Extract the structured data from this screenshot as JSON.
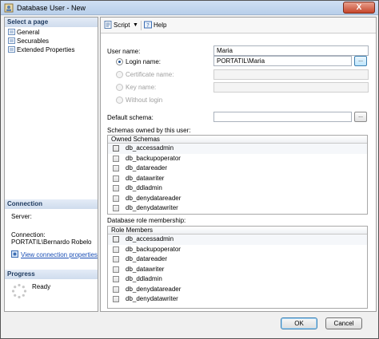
{
  "window": {
    "title": "Database User - New",
    "close_label": "X"
  },
  "left_pane": {
    "select_page_header": "Select a page",
    "pages": [
      "General",
      "Securables",
      "Extended Properties"
    ],
    "connection_header": "Connection",
    "server_label": "Server:",
    "connection_label": "Connection:",
    "connection_value": "PORTATIL\\Bernardo Robelo",
    "view_connection_link": "View connection properties",
    "progress_header": "Progress",
    "progress_status": "Ready"
  },
  "toolbar": {
    "script_label": "Script",
    "help_label": "Help"
  },
  "general": {
    "user_name_label": "User name:",
    "user_name_value": "Maria",
    "login_name_label": "Login name:",
    "login_name_value": "PORTATIL\\Maria",
    "certificate_label": "Certificate name:",
    "key_label": "Key name:",
    "without_login_label": "Without login",
    "default_schema_label": "Default schema:",
    "default_schema_value": "",
    "browse_label": "...",
    "schemas_label": "Schemas owned by this user:",
    "schemas_header": "Owned Schemas",
    "schemas": [
      "db_accessadmin",
      "db_backupoperator",
      "db_datareader",
      "db_datawriter",
      "db_ddladmin",
      "db_denydatareader",
      "db_denydatawriter"
    ],
    "roles_label": "Database role membership:",
    "roles_header": "Role Members",
    "roles": [
      "db_accessadmin",
      "db_backupoperator",
      "db_datareader",
      "db_datawriter",
      "db_ddladmin",
      "db_denydatareader",
      "db_denydatawriter"
    ]
  },
  "buttons": {
    "ok_label": "OK",
    "cancel_label": "Cancel"
  }
}
